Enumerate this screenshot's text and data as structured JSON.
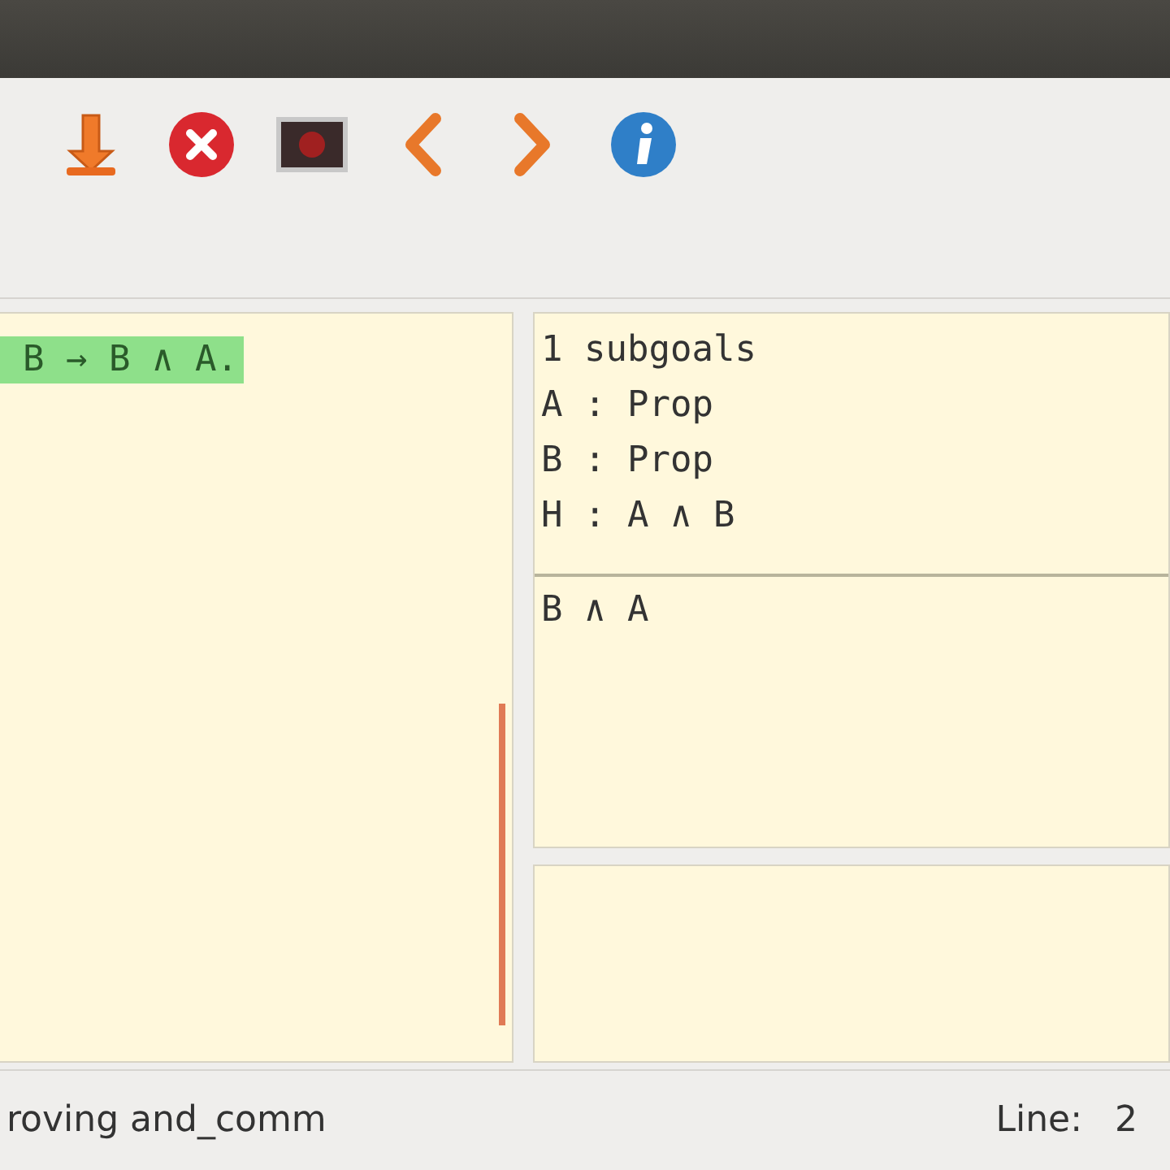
{
  "toolbar": {
    "buttons": [
      {
        "kind": "down"
      },
      {
        "kind": "stop"
      },
      {
        "kind": "screen"
      },
      {
        "kind": "back"
      },
      {
        "kind": "forward"
      },
      {
        "kind": "info"
      }
    ]
  },
  "script_pane": {
    "lines": [
      {
        "text": "B → B ∧ A.",
        "processed": true
      }
    ]
  },
  "goals_pane": {
    "subgoal_count": "1 subgoals",
    "hypotheses": [
      "A : Prop",
      "B : Prop",
      "H : A ∧ B"
    ],
    "conclusion": "B ∧ A"
  },
  "status_bar": {
    "file": "roving and_comm",
    "line_label": "Line:",
    "line_value": "2"
  }
}
